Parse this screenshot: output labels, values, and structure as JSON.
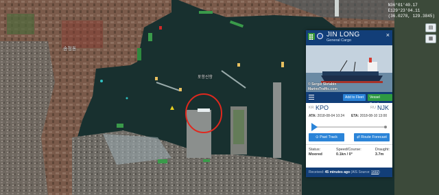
{
  "map": {
    "coords_line1": "N36°01'40.17",
    "coords_line2": "E129°23'04.11",
    "coords_line3": "(36.0278, 129.3845)",
    "label_district": "송정동",
    "label_port": "포항신항",
    "highlight_color": "#e0281e",
    "controls": [
      {
        "icon": "layers-icon",
        "glyph": "▤"
      },
      {
        "icon": "map-type-icon",
        "glyph": "▦"
      }
    ]
  },
  "vessel": {
    "name": "JIN LONG",
    "type": "General Cargo",
    "photo_credit": "© Sergei Skriabin",
    "photo_brand": "MarineTraffic.com",
    "add_to_fleet": "Add to Fleet",
    "vessel_details": "Vessel Details",
    "origin_country": "KR",
    "origin_port": "KPO",
    "dest_country": "RU",
    "dest_port": "NJK",
    "ata_label": "ATA:",
    "ata_value": "2018-08-04 10:24",
    "eta_label": "ETA:",
    "eta_value": "2018-08-10 13:00",
    "progress": 0.03,
    "past_track": "Past Track",
    "route_forecast": "Route Forecast",
    "status_label": "Status:",
    "status_value": "Moored",
    "speed_label": "Speed/Course:",
    "speed_value": "0.1kn / 0°",
    "draught_label": "Draught:",
    "draught_value": "3.7m",
    "received_label": "Received:",
    "received_value": "45 minutes ago",
    "ais_source_prefix": "(AIS Source:",
    "ais_source": "1602",
    "ais_source_suffix": ")",
    "colors": {
      "header": "#123e78",
      "button_blue": "#2b84d8",
      "button_green": "#2e9a42"
    }
  }
}
